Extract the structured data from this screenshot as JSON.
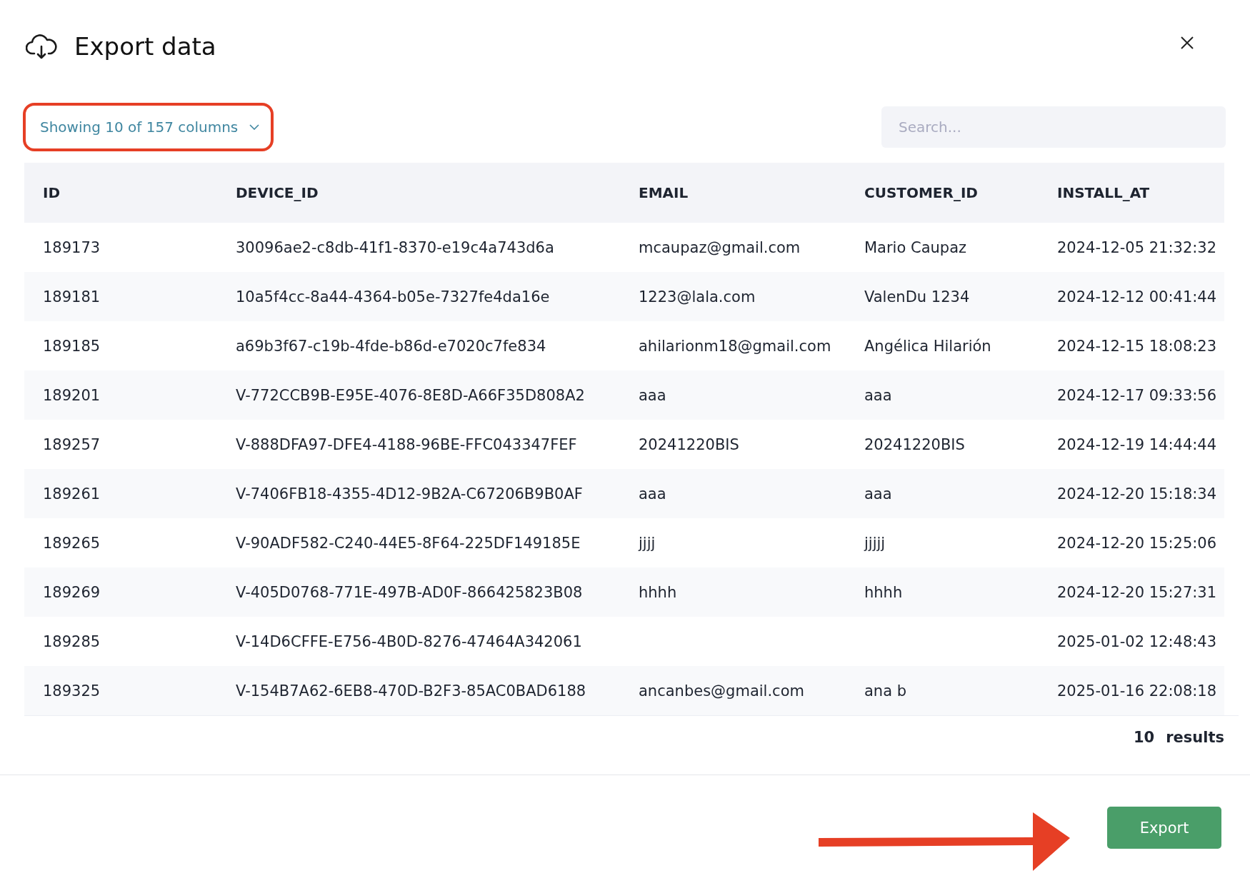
{
  "dialog": {
    "title": "Export data"
  },
  "columns_picker": {
    "label": "Showing 10 of 157 columns",
    "highlighted": true
  },
  "search": {
    "placeholder": "Search..."
  },
  "table": {
    "columns": [
      "ID",
      "DEVICE_ID",
      "EMAIL",
      "CUSTOMER_ID",
      "INSTALL_AT"
    ],
    "rows": [
      [
        "189173",
        "30096ae2-c8db-41f1-8370-e19c4a743d6a",
        "mcaupaz@gmail.com",
        "Mario Caupaz",
        "2024-12-05 21:32:32"
      ],
      [
        "189181",
        "10a5f4cc-8a44-4364-b05e-7327fe4da16e",
        "1223@lala.com",
        "ValenDu 1234",
        "2024-12-12 00:41:44"
      ],
      [
        "189185",
        "a69b3f67-c19b-4fde-b86d-e7020c7fe834",
        "ahilarionm18@gmail.com",
        "Angélica Hilarión",
        "2024-12-15 18:08:23"
      ],
      [
        "189201",
        "V-772CCB9B-E95E-4076-8E8D-A66F35D808A2",
        "aaa",
        "aaa",
        "2024-12-17 09:33:56"
      ],
      [
        "189257",
        "V-888DFA97-DFE4-4188-96BE-FFC043347FEF",
        "20241220BIS",
        "20241220BIS",
        "2024-12-19 14:44:44"
      ],
      [
        "189261",
        "V-7406FB18-4355-4D12-9B2A-C67206B9B0AF",
        "aaa",
        "aaa",
        "2024-12-20 15:18:34"
      ],
      [
        "189265",
        "V-90ADF582-C240-44E5-8F64-225DF149185E",
        "jjjj",
        "jjjjj",
        "2024-12-20 15:25:06"
      ],
      [
        "189269",
        "V-405D0768-771E-497B-AD0F-866425823B08",
        "hhhh",
        "hhhh",
        "2024-12-20 15:27:31"
      ],
      [
        "189285",
        "V-14D6CFFE-E756-4B0D-8276-47464A342061",
        "",
        "",
        "2025-01-02 12:48:43"
      ],
      [
        "189325",
        "V-154B7A62-6EB8-470D-B2F3-85AC0BAD6188",
        "ancanbes@gmail.com",
        "ana b",
        "2025-01-16 22:08:18"
      ]
    ]
  },
  "results": {
    "count": "10",
    "label": "results"
  },
  "footer": {
    "buttons": [
      "Export"
    ],
    "arrow_annotation": true
  }
}
